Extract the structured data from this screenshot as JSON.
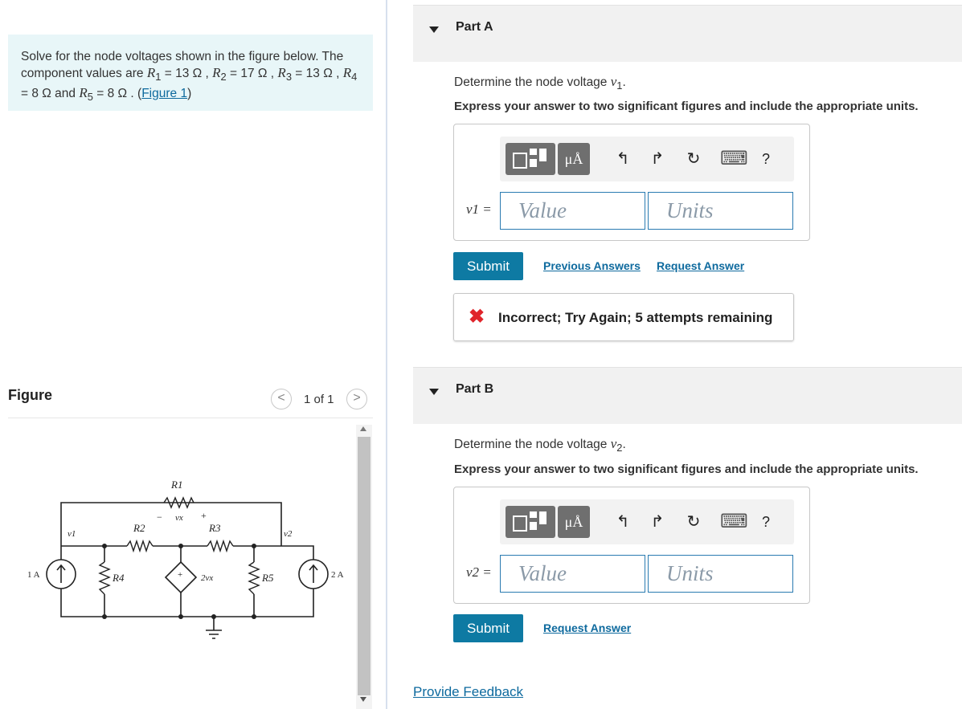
{
  "problem": {
    "intro": "Solve for the node voltages shown in the figure below. The component values are ",
    "r1_sym": "R",
    "r1_sub": "1",
    "r1_val": " = 13 Ω , ",
    "r2_sym": "R",
    "r2_sub": "2",
    "r2_val": " = 17 Ω , ",
    "r3_sym": "R",
    "r3_sub": "3",
    "r3_val": " = 13 Ω , ",
    "r4_sym": "R",
    "r4_sub": "4",
    "r4_val": " = 8 Ω and ",
    "r5_sym": "R",
    "r5_sub": "5",
    "r5_val": " = 8 Ω . (",
    "figure_link": "Figure 1",
    "close_paren": ")"
  },
  "figure": {
    "label": "Figure",
    "pager_prev": "<",
    "pager_next": ">",
    "pager_text": "1 of 1",
    "circuit": {
      "r1": "R1",
      "r2": "R2",
      "r3": "R3",
      "r4": "R4",
      "r5": "R5",
      "v1": "v1",
      "v2": "v2",
      "vx": "vx",
      "minus": "−",
      "plus": "+",
      "src_left": "1 A",
      "src_right": "2 A",
      "dep_src": "2vx"
    }
  },
  "partA": {
    "title": "Part A",
    "prompt": "Determine the node voltage ",
    "var_sym": "v",
    "var_sub": "1",
    "period": ".",
    "express": "Express your answer to two significant figures and include the appropriate units.",
    "var_label": "v1 =",
    "value_placeholder": "Value",
    "units_placeholder": "Units",
    "submit": "Submit",
    "prev_answers": "Previous Answers",
    "request_answer": "Request Answer",
    "feedback": "Incorrect; Try Again; 5 attempts remaining",
    "feedback_icon": "✖"
  },
  "partB": {
    "title": "Part B",
    "prompt": "Determine the node voltage ",
    "var_sym": "v",
    "var_sub": "2",
    "period": ".",
    "express": "Express your answer to two significant figures and include the appropriate units.",
    "var_label": "v2 =",
    "value_placeholder": "Value",
    "units_placeholder": "Units",
    "submit": "Submit",
    "request_answer": "Request Answer"
  },
  "toolbar": {
    "units_btn": "μÅ",
    "undo": "↰",
    "redo": "↱",
    "reset": "↻",
    "keyboard": "⌨",
    "help": "?"
  },
  "footer": {
    "provide_feedback": "Provide Feedback"
  }
}
